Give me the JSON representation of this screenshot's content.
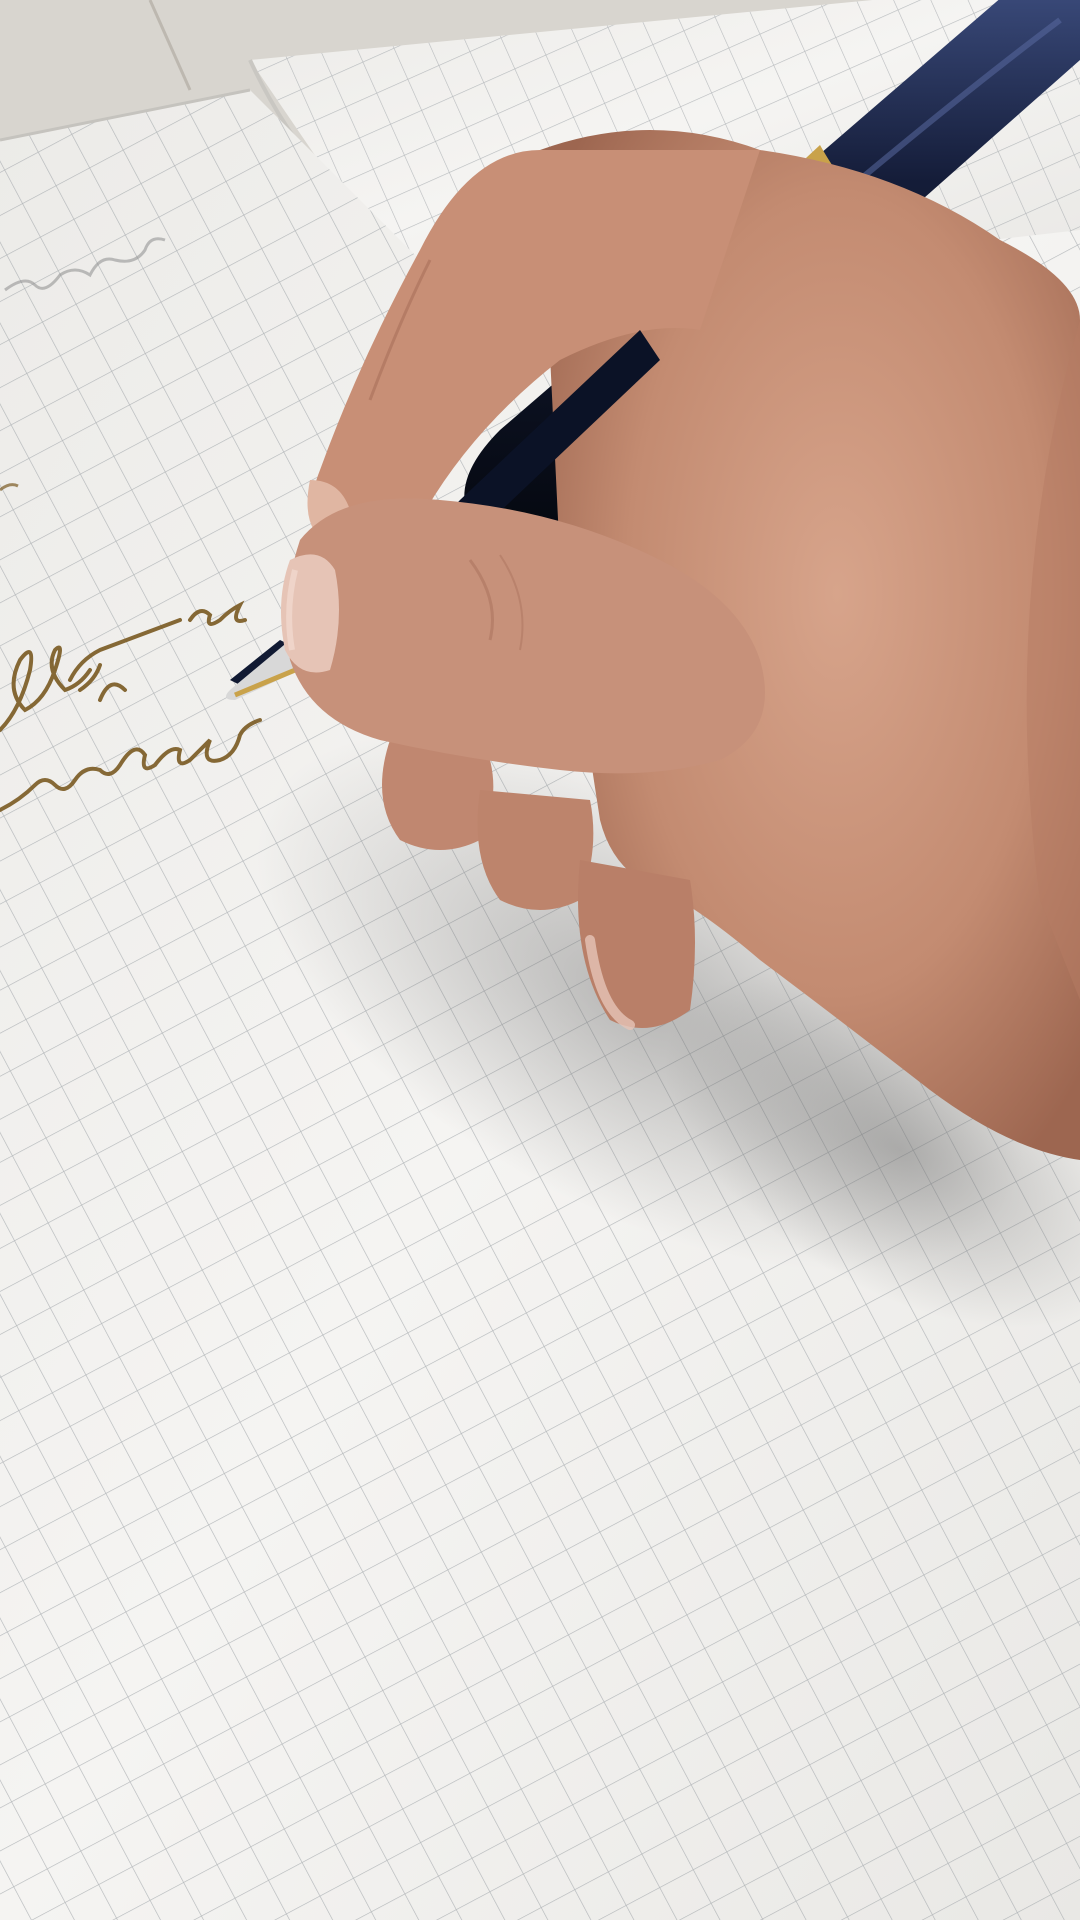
{
  "scene": {
    "description_label": "",
    "colors": {
      "table": "#d8d5cf",
      "paper": "#f4f3f1",
      "paper_shadow": "#dcdad6",
      "grid": "#9fa4a8",
      "ink": "#7a5a22",
      "pencil_faint": "#8c8c8c",
      "skin": "#c9927a",
      "skin_dark": "#a8705a",
      "skin_light": "#dcae96",
      "nail": "#e6c4b6",
      "pen_body": "#111a33",
      "pen_highlight": "#3a4a7a",
      "pen_gold": "#c9a24a",
      "nib_silver": "#d8d8d8"
    },
    "icons": [
      "fountain-pen-icon",
      "hand-icon",
      "grid-notebook-icon"
    ]
  }
}
